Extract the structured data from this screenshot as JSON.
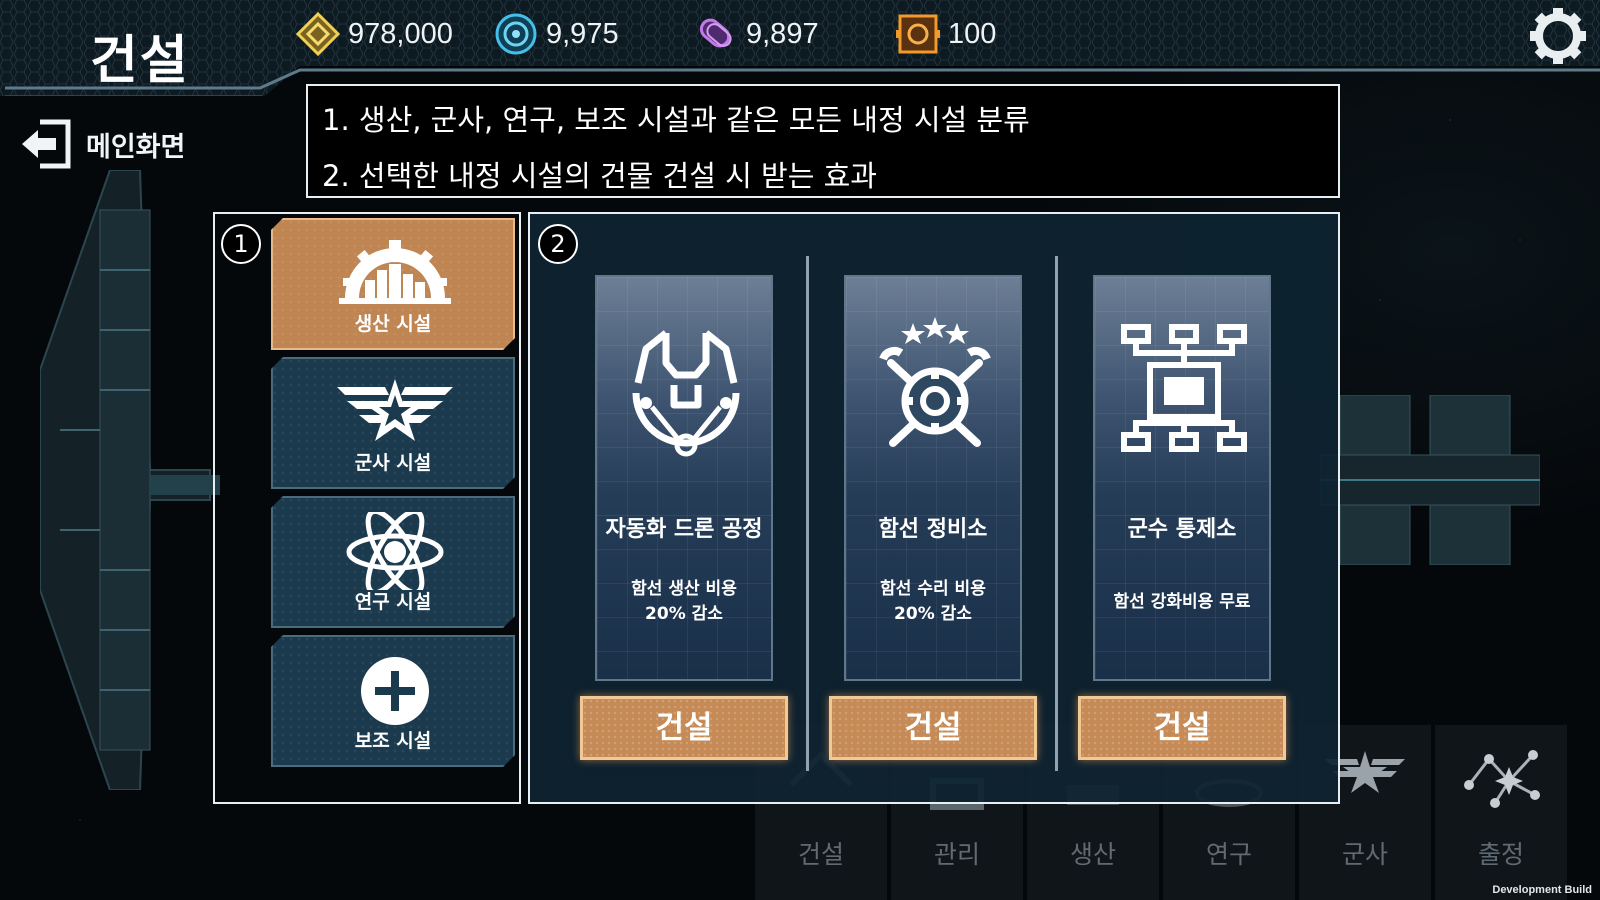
{
  "header": {
    "title": "건설",
    "resources": [
      {
        "icon": "gold-diamond-icon",
        "value": "978,000",
        "color": "#e9c44a"
      },
      {
        "icon": "blue-orb-icon",
        "value": "9,975",
        "color": "#3fb4e0"
      },
      {
        "icon": "purple-crystal-icon",
        "value": "9,897",
        "color": "#b56ee0"
      },
      {
        "icon": "orange-chip-icon",
        "value": "100",
        "color": "#f0952a"
      }
    ],
    "settings_icon": "gear-icon"
  },
  "back": {
    "label": "메인화면",
    "icon": "exit-door-icon"
  },
  "tutorial_note": {
    "line1": "1.  생산, 군사, 연구, 보조 시설과 같은 모든 내정 시설 분류",
    "line2": "2.  선택한 내정 시설의 건물 건설 시 받는 효과"
  },
  "markers": {
    "one": "1",
    "two": "2"
  },
  "categories": [
    {
      "label": "생산 시설",
      "icon": "factory-gear-icon",
      "active": true
    },
    {
      "label": "군사 시설",
      "icon": "wings-star-icon",
      "active": false
    },
    {
      "label": "연구 시설",
      "icon": "atom-icon",
      "active": false
    },
    {
      "label": "보조 시설",
      "icon": "plus-circle-icon",
      "active": false
    }
  ],
  "buildings": [
    {
      "name": "자동화 드론 공정",
      "effect_line1": "함선 생산 비용",
      "effect_line2": "20% 감소",
      "icon": "drone-claw-icon",
      "button": "건설"
    },
    {
      "name": "함선 정비소",
      "effect_line1": "함선 수리 비용",
      "effect_line2": "20% 감소",
      "icon": "wrench-gear-icon",
      "button": "건설"
    },
    {
      "name": "군수 통제소",
      "effect_line1": "함선 강화비용 무료",
      "effect_line2": "",
      "icon": "network-diagram-icon",
      "button": "건설"
    }
  ],
  "bottom_nav": [
    {
      "label": "건설",
      "icon": "build-icon"
    },
    {
      "label": "관리",
      "icon": "manage-icon"
    },
    {
      "label": "생산",
      "icon": "production-icon"
    },
    {
      "label": "연구",
      "icon": "research-icon"
    },
    {
      "label": "군사",
      "icon": "wings-star-icon"
    },
    {
      "label": "출정",
      "icon": "constellation-icon"
    }
  ],
  "dev_build": "Development Build"
}
